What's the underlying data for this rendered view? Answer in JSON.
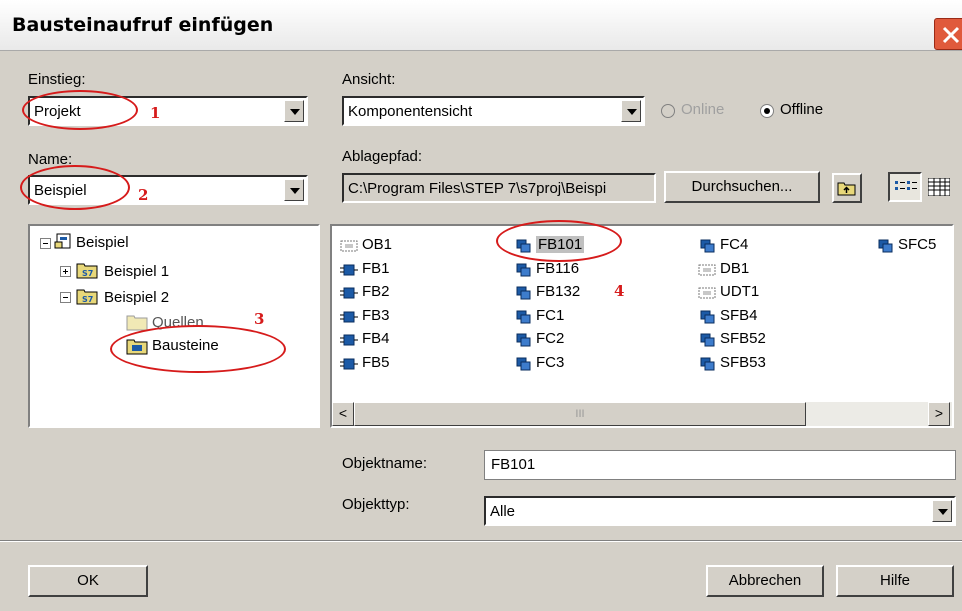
{
  "window": {
    "title": "Bausteinaufruf einfügen"
  },
  "entry": {
    "label": "Einstieg:",
    "value": "Projekt"
  },
  "view": {
    "label": "Ansicht:",
    "value": "Komponentensicht",
    "online_label": "Online",
    "offline_label": "Offline",
    "selected_mode": "Offline"
  },
  "name": {
    "label": "Name:",
    "value": "Beispiel"
  },
  "path": {
    "label": "Ablagepfad:",
    "value": "C:\\Program Files\\STEP 7\\s7proj\\Beispi",
    "browse_label": "Durchsuchen..."
  },
  "tree": {
    "root": "Beispiel",
    "items": [
      "Beispiel 1",
      "Beispiel 2",
      "Quellen",
      "Bausteine"
    ]
  },
  "blocks": {
    "columns": [
      [
        "OB1",
        "FB1",
        "FB2",
        "FB3",
        "FB4",
        "FB5"
      ],
      [
        "FB101",
        "FB116",
        "FB132",
        "FC1",
        "FC2",
        "FC3"
      ],
      [
        "FC4",
        "DB1",
        "UDT1",
        "SFB4",
        "SFB52",
        "SFB53"
      ],
      [
        "SFC5"
      ]
    ],
    "selected": "FB101"
  },
  "scroll": {
    "thumb_glyph": "III",
    "left_glyph": "<",
    "right_glyph": ">"
  },
  "object_name": {
    "label": "Objektname:",
    "value": "FB101"
  },
  "object_type": {
    "label": "Objekttyp:",
    "value": "Alle"
  },
  "buttons": {
    "ok": "OK",
    "cancel": "Abbrechen",
    "help": "Hilfe"
  },
  "annotations": [
    "1",
    "2",
    "3",
    "4"
  ],
  "colors": {
    "annotation": "#d61b1b",
    "dialog_bg": "#d4d0c8",
    "selection": "#c0c0c0"
  }
}
